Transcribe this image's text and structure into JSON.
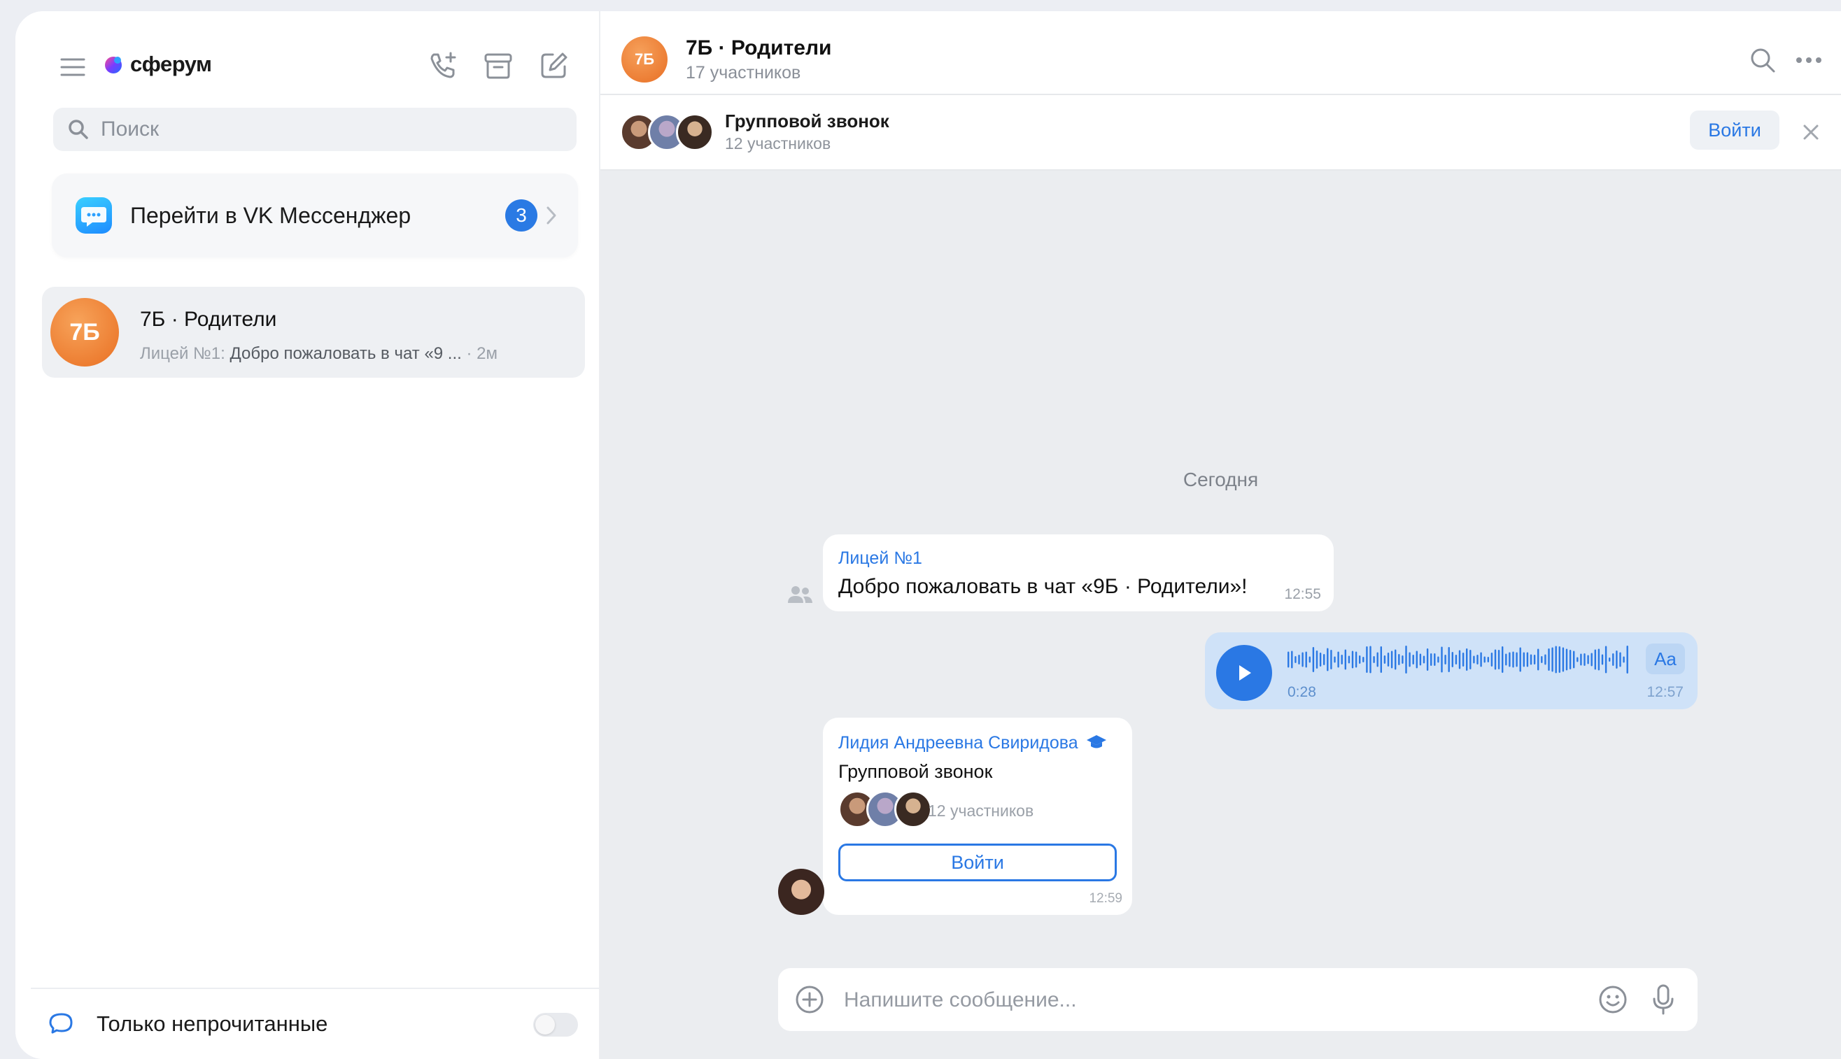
{
  "app": {
    "name": "сферум"
  },
  "search": {
    "placeholder": "Поиск"
  },
  "vk_promo": {
    "label": "Перейти в VK Мессенджер",
    "badge": "3"
  },
  "chat_list": [
    {
      "avatar": "7Б",
      "name": "7Б · Родители",
      "sender": "Лицей №1:",
      "preview": "Добро пожаловать в чат «9 ...",
      "time": "2м"
    }
  ],
  "footer": {
    "label": "Только непрочитанные"
  },
  "conversation": {
    "avatar": "7Б",
    "title": "7Б · Родители",
    "subtitle": "17 участников"
  },
  "call_banner": {
    "title": "Групповой звонок",
    "subtitle": "12 участников",
    "join_label": "Войти"
  },
  "messages": {
    "date_separator": "Сегодня",
    "welcome": {
      "author": "Лицей №1",
      "text": "Добро пожаловать в чат «9Б · Родители»!",
      "time": "12:55"
    },
    "voice": {
      "duration": "0:28",
      "time": "12:57",
      "transcribe_label": "Aa"
    },
    "call": {
      "author": "Лидия Андреевна Свиридова",
      "title": "Групповой звонок",
      "participants": "12 участников",
      "join_label": "Войти",
      "time": "12:59"
    }
  },
  "composer": {
    "placeholder": "Напишите сообщение..."
  },
  "colors": {
    "accent": "#2a78e4",
    "avatar_orange": "#ee7a2c",
    "voice_bubble": "#cfe2f8"
  },
  "icons": [
    "menu-icon",
    "sferum-logo-icon",
    "add-call-icon",
    "archive-icon",
    "compose-icon",
    "search-icon",
    "chevron-right-icon",
    "chat-bubble-icon",
    "more-icon",
    "close-icon",
    "group-icon",
    "play-icon",
    "graduation-cap-icon",
    "add-icon",
    "emoji-icon",
    "microphone-icon"
  ]
}
